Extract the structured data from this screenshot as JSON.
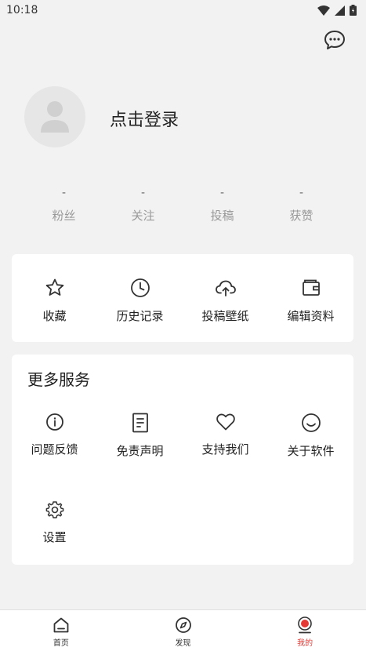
{
  "status_bar": {
    "time": "10:18"
  },
  "profile": {
    "login_text": "点击登录"
  },
  "stats": [
    {
      "value": "-",
      "label": "粉丝"
    },
    {
      "value": "-",
      "label": "关注"
    },
    {
      "value": "-",
      "label": "投稿"
    },
    {
      "value": "-",
      "label": "获赞"
    }
  ],
  "quick_actions": [
    {
      "label": "收藏",
      "icon": "star-icon"
    },
    {
      "label": "历史记录",
      "icon": "clock-icon"
    },
    {
      "label": "投稿壁纸",
      "icon": "cloud-upload-icon"
    },
    {
      "label": "编辑资料",
      "icon": "wallet-icon"
    }
  ],
  "more_services": {
    "title": "更多服务",
    "items": [
      {
        "label": "问题反馈",
        "icon": "info-icon"
      },
      {
        "label": "免责声明",
        "icon": "document-icon"
      },
      {
        "label": "支持我们",
        "icon": "heart-icon"
      },
      {
        "label": "关于软件",
        "icon": "smile-icon"
      },
      {
        "label": "设置",
        "icon": "gear-icon"
      }
    ]
  },
  "bottom_nav": [
    {
      "label": "首页",
      "icon": "home-icon"
    },
    {
      "label": "发现",
      "icon": "compass-icon"
    },
    {
      "label": "我的",
      "icon": "profile-icon",
      "active": true
    }
  ],
  "colors": {
    "accent": "#e53935",
    "background": "#f2f2f2",
    "card": "#ffffff"
  }
}
